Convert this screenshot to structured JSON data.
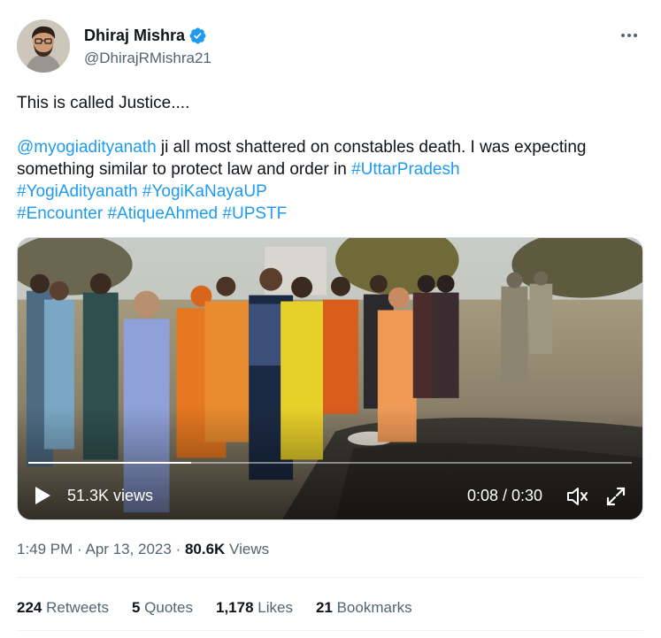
{
  "author": {
    "display_name": "Dhiraj Mishra",
    "handle": "@DhirajRMishra21",
    "verified_icon": "verified-badge-icon",
    "accent_color": "#1d9bf0"
  },
  "tweet": {
    "line1": "This is called Justice....",
    "mention": "@myogiadityanath",
    "body_text": " ji all most shattered on constables death. I was expecting something similar to protect law and order in ",
    "hashtags": {
      "h1": "#UttarPradesh",
      "h2": "#YogiAdityanath",
      "h3": "#YogiKaNayaUP",
      "h4": "#Encounter",
      "h5": "#AtiqueAhmed",
      "h6": "#UPSTF"
    }
  },
  "video": {
    "views": "51.3K views",
    "time": "0:08 / 0:30",
    "progress_fraction": 0.27,
    "play_icon": "play-icon",
    "volume_icon": "volume-icon",
    "fullscreen_icon": "fullscreen-icon"
  },
  "meta": {
    "time": "1:49 PM",
    "sep1": " · ",
    "date": "Apr 13, 2023",
    "sep2": " · ",
    "views_count": "80.6K",
    "views_label": " Views"
  },
  "stats": {
    "retweets_count": "224",
    "retweets_label": " Retweets",
    "quotes_count": "5",
    "quotes_label": " Quotes",
    "likes_count": "1,178",
    "likes_label": " Likes",
    "bookmarks_count": "21",
    "bookmarks_label": " Bookmarks"
  }
}
